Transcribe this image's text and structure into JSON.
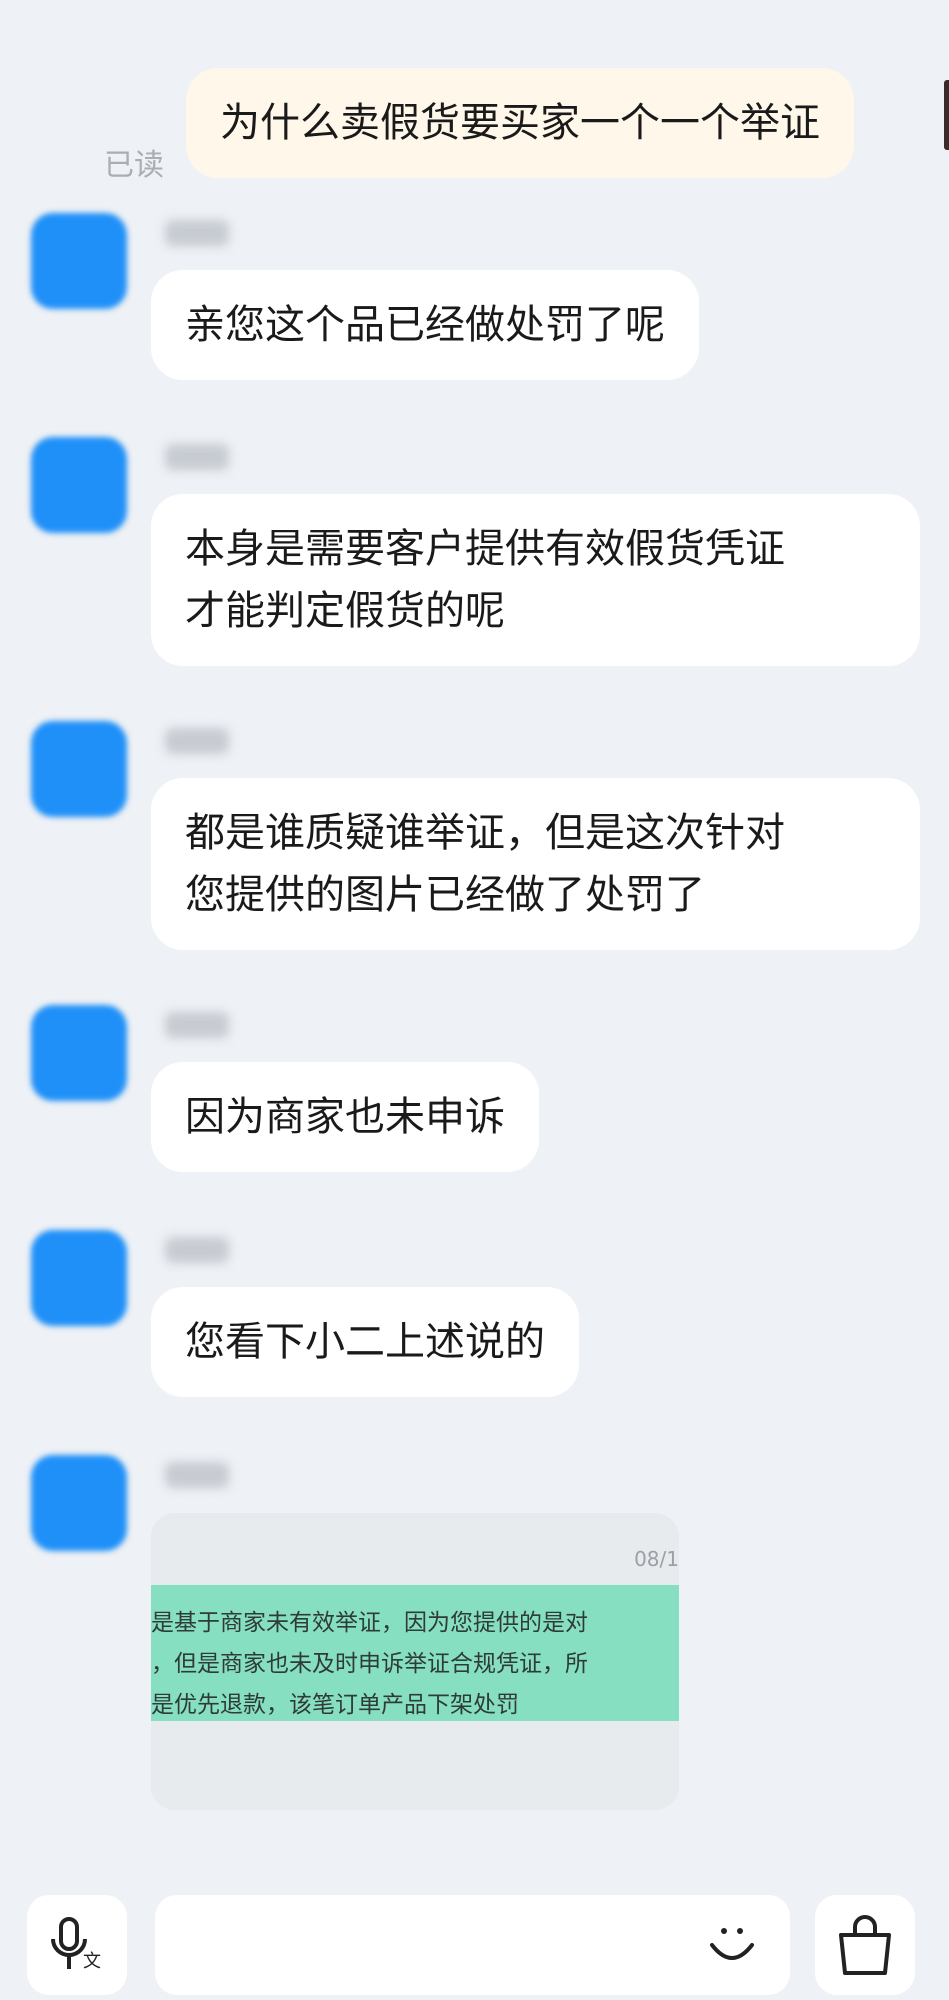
{
  "outgoing": {
    "text": "为什么卖假货要买家一个一个举证",
    "status": "已读"
  },
  "incoming": [
    {
      "lines": [
        "亲您这个品已经做处罚了呢"
      ]
    },
    {
      "lines": [
        "本身是需要客户提供有效假货凭证",
        "才能判定假货的呢"
      ]
    },
    {
      "lines": [
        "都是谁质疑谁举证，但是这次针对",
        "您提供的图片已经做了处罚了"
      ]
    },
    {
      "lines": [
        "因为商家也未申诉"
      ]
    },
    {
      "lines": [
        "您看下小二上述说的"
      ]
    }
  ],
  "image_message": {
    "timestamp": "08/1",
    "lines": [
      "是基于商家未有效举证，因为您提供的是对",
      "，但是商家也未及时申诉举证合规凭证，所",
      "是优先退款，该笔订单产品下架处罚"
    ]
  },
  "composer": {
    "voice_icon": "voice-translate-icon",
    "emoji_icon": "smiley-icon",
    "more_icon": "shopping-bag-icon"
  }
}
